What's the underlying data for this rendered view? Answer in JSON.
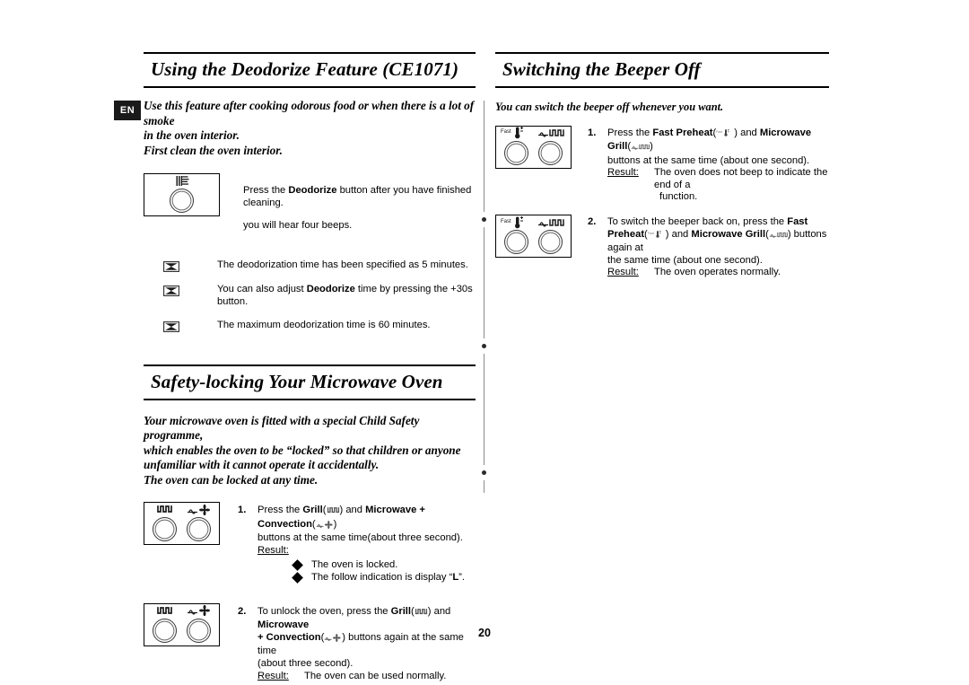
{
  "page": {
    "language_badge": "EN",
    "page_number": "20"
  },
  "left_column": {
    "section1": {
      "heading": "Using the Deodorize Feature (CE1071)",
      "intro_lines": [
        "Use this feature after cooking odorous food or when there is a lot of smoke",
        "in the oven interior.",
        "First clean the oven interior."
      ],
      "instruction": {
        "panel_icon": "deodorize-symbol",
        "line1_pre": "Press the ",
        "line1_bold": "Deodorize",
        "line1_post": " button after you have finished cleaning.",
        "line2": "you will hear four beeps."
      },
      "notes": [
        {
          "icon": "note-rect-icon",
          "pre": "The deodorization time has been specified as 5 minutes.",
          "bold": "",
          "post": ""
        },
        {
          "icon": "note-rect-icon",
          "pre": "You can also adjust ",
          "bold": "Deodorize",
          "post": " time by pressing the +30s button."
        },
        {
          "icon": "note-rect-icon",
          "pre": "The maximum deodorization time is 60 minutes.",
          "bold": "",
          "post": ""
        }
      ]
    },
    "section2": {
      "heading": "Safety-locking Your Microwave Oven",
      "intro_lines": [
        "Your microwave oven is fitted with a special Child Safety programme,",
        "which enables the oven to be “locked” so that children or anyone",
        "unfamiliar with it cannot operate it accidentally.",
        "The oven can be locked at any time."
      ],
      "steps": [
        {
          "number": "1.",
          "panel": {
            "left_symbol": "grill-icon",
            "right_symbol": "microwave-convection-icon"
          },
          "text_pre": "Press the ",
          "bold1": "Grill",
          "mid1": "(",
          "icon1": "grill-icon",
          "mid2": ") and ",
          "bold2": "Microwave + Convection",
          "mid3": "(",
          "icon2": "microwave-convection-icon",
          "mid4": ")",
          "line2": "buttons at the same time(about three second).",
          "result_label": "Result:",
          "bullets": [
            {
              "pre": "The oven is locked.",
              "bold": "",
              "post": ""
            },
            {
              "pre": "The follow indication is display “",
              "bold": "L",
              "post": "”."
            }
          ]
        },
        {
          "number": "2.",
          "panel": {
            "left_symbol": "grill-icon",
            "right_symbol": "microwave-convection-icon"
          },
          "text_pre": "To unlock the oven, press the ",
          "bold1": "Grill",
          "mid1": "(",
          "icon1": "grill-icon",
          "mid2": ") and ",
          "bold2": "Microwave",
          "line2_bold": "+ Convection",
          "line2_mid1": "(",
          "line2_icon": "microwave-convection-icon",
          "line2_mid2": ") buttons again at the same time",
          "line3": "(about three second).",
          "result_label": "Result:",
          "result_text": "The oven can be used normally."
        }
      ]
    }
  },
  "right_column": {
    "section1": {
      "heading": "Switching the Beeper Off",
      "intro_lines": [
        "You can switch the beeper off whenever you want."
      ],
      "steps": [
        {
          "number": "1.",
          "panel": {
            "left_symbol": "fast-preheat-icon",
            "left_label": "Fast",
            "right_symbol": "microwave-grill-icon"
          },
          "text_pre": "Press the ",
          "bold1": "Fast Preheat",
          "mid1": "(",
          "icon1": "fast-preheat-icon",
          "mid2": ") and ",
          "bold2": "Microwave Grill",
          "mid3": "(",
          "icon2": "microwave-grill-icon",
          "mid4": ")",
          "line2": "buttons at the same time (about one second).",
          "result_label": "Result:",
          "result_text": "The oven does not beep to indicate the end of a",
          "result_text2": "function."
        },
        {
          "number": "2.",
          "panel": {
            "left_symbol": "fast-preheat-icon",
            "left_label": "Fast",
            "right_symbol": "microwave-grill-icon"
          },
          "text_pre": "To switch the beeper back on, press the ",
          "bold1": "Fast",
          "line2_bold": "Preheat",
          "line2_mid1": "(",
          "line2_icon1": "fast-preheat-icon",
          "line2_mid2": ") and ",
          "line2_bold2": "Microwave Grill",
          "line2_mid3": "(",
          "line2_icon2": "microwave-grill-icon",
          "line2_mid4": ") buttons again at",
          "line3": "the same time (about one second).",
          "result_label": "Result:",
          "result_text": "The oven operates normally."
        }
      ]
    }
  }
}
